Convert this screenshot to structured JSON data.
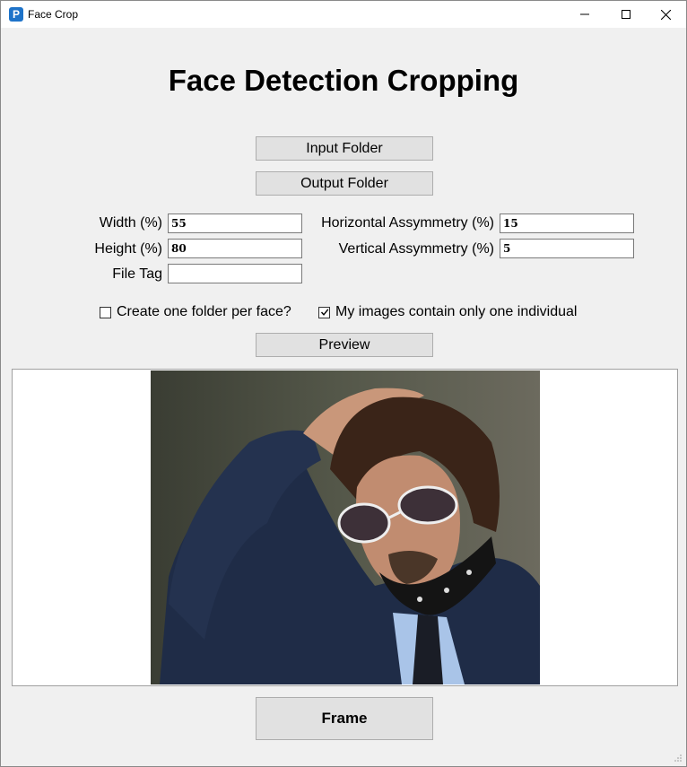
{
  "window": {
    "title": "Face Crop",
    "icon": "app-icon",
    "icon_letter": "P"
  },
  "heading": "Face Detection Cropping",
  "buttons": {
    "input_folder": "Input Folder",
    "output_folder": "Output Folder",
    "preview": "Preview",
    "frame": "Frame"
  },
  "fields": {
    "width": {
      "label": "Width (%)",
      "value": "55"
    },
    "height": {
      "label": "Height (%)",
      "value": "80"
    },
    "file_tag": {
      "label": "File Tag",
      "value": ""
    },
    "horizontal": {
      "label": "Horizontal Assymmetry (%)",
      "value": "15"
    },
    "vertical": {
      "label": "Vertical Assymmetry (%)",
      "value": "5"
    }
  },
  "checkboxes": {
    "folder_per_face": {
      "label": "Create one folder per face?",
      "checked": false
    },
    "one_individual": {
      "label": "My images contain only one individual",
      "checked": true
    }
  },
  "preview_image": {
    "icon": "person-portrait-photo"
  }
}
